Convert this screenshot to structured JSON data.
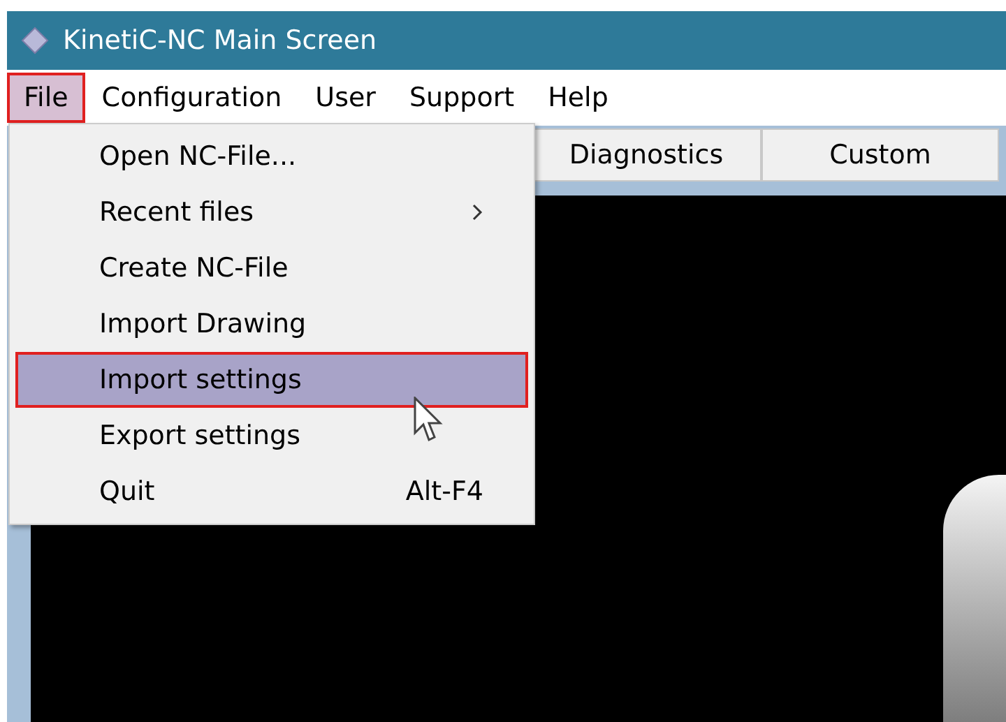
{
  "window": {
    "title": "KinetiC-NC Main Screen"
  },
  "menu_bar": [
    {
      "label": "File",
      "selected": true
    },
    {
      "label": "Configuration",
      "selected": false
    },
    {
      "label": "User",
      "selected": false
    },
    {
      "label": "Support",
      "selected": false
    },
    {
      "label": "Help",
      "selected": false
    }
  ],
  "tabs": [
    {
      "label": "Diagnostics"
    },
    {
      "label": "Custom"
    }
  ],
  "file_menu": [
    {
      "label": "Open NC-File...",
      "selected": false
    },
    {
      "label": "Recent files",
      "selected": false,
      "submenu": true
    },
    {
      "label": "Create NC-File",
      "selected": false
    },
    {
      "label": "Import Drawing",
      "selected": false
    },
    {
      "label": "Import settings",
      "selected": true
    },
    {
      "label": "Export settings",
      "selected": false
    },
    {
      "label": "Quit",
      "selected": false,
      "shortcut": "Alt-F4"
    }
  ]
}
